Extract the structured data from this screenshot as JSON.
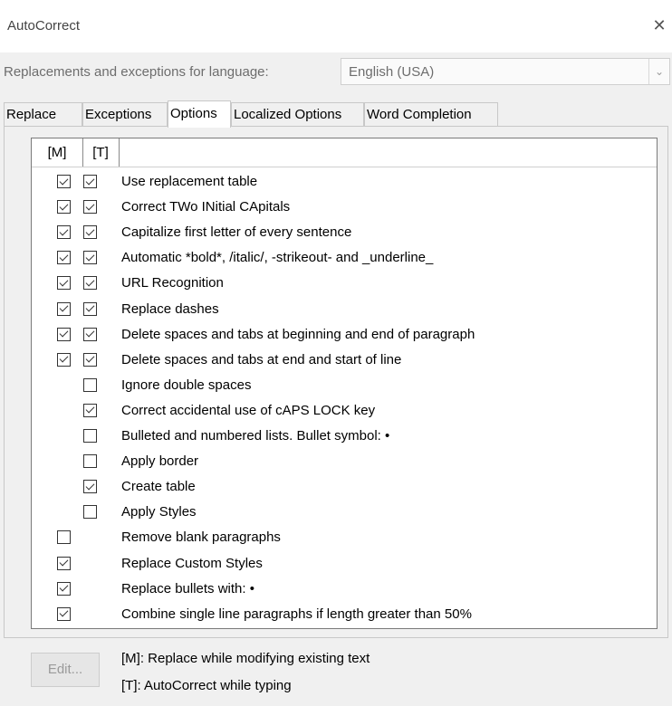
{
  "window": {
    "title": "AutoCorrect",
    "close_glyph": "✕"
  },
  "language": {
    "label": "Replacements and exceptions for language:",
    "selected": "English (USA)"
  },
  "tabs": [
    {
      "label": "Replace",
      "active": false
    },
    {
      "label": "Exceptions",
      "active": false
    },
    {
      "label": "Options",
      "active": true
    },
    {
      "label": "Localized Options",
      "active": false
    },
    {
      "label": "Word Completion",
      "active": false
    }
  ],
  "options_table": {
    "headers": {
      "m": "[M]",
      "t": "[T]",
      "label": ""
    },
    "rows": [
      {
        "label": "Use replacement table",
        "m": true,
        "t": true
      },
      {
        "label": "Correct TWo INitial CApitals",
        "m": true,
        "t": true
      },
      {
        "label": "Capitalize first letter of every sentence",
        "m": true,
        "t": true
      },
      {
        "label": "Automatic *bold*, /italic/, -strikeout- and _underline_",
        "m": true,
        "t": true
      },
      {
        "label": "URL Recognition",
        "m": true,
        "t": true
      },
      {
        "label": "Replace dashes",
        "m": true,
        "t": true
      },
      {
        "label": "Delete spaces and tabs at beginning and end of paragraph",
        "m": true,
        "t": true
      },
      {
        "label": "Delete spaces and tabs at end and start of line",
        "m": true,
        "t": true
      },
      {
        "label": "Ignore double spaces",
        "m": null,
        "t": false
      },
      {
        "label": "Correct accidental use of cAPS LOCK key",
        "m": null,
        "t": true
      },
      {
        "label": "Bulleted and numbered lists. Bullet symbol: •",
        "m": null,
        "t": false
      },
      {
        "label": "Apply border",
        "m": null,
        "t": false
      },
      {
        "label": "Create table",
        "m": null,
        "t": true
      },
      {
        "label": "Apply Styles",
        "m": null,
        "t": false
      },
      {
        "label": "Remove blank paragraphs",
        "m": false,
        "t": null
      },
      {
        "label": "Replace Custom Styles",
        "m": true,
        "t": null
      },
      {
        "label": "Replace bullets with: •",
        "m": true,
        "t": null
      },
      {
        "label": "Combine single line paragraphs if length greater than 50%",
        "m": true,
        "t": null
      }
    ]
  },
  "footer": {
    "edit_button": "Edit...",
    "legend_m": "[M]: Replace while modifying existing text",
    "legend_t": "[T]: AutoCorrect while typing"
  }
}
